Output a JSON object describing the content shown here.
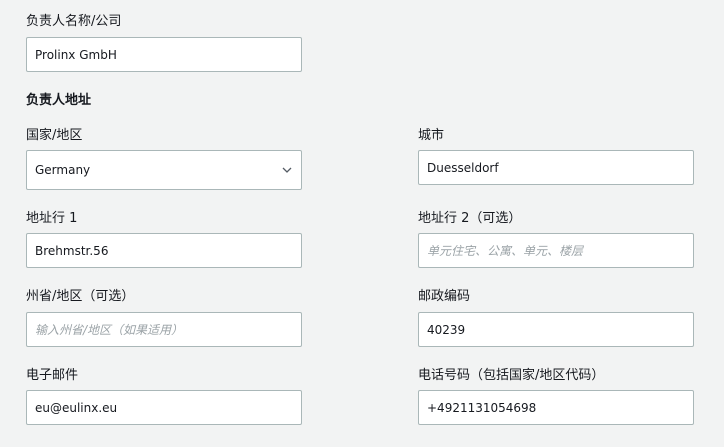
{
  "owner": {
    "name_label": "负责人名称/公司",
    "name_value": "Prolinx GmbH",
    "address_section_title": "负责人地址"
  },
  "country": {
    "label": "国家/地区",
    "value": "Germany"
  },
  "city": {
    "label": "城市",
    "value": "Duesseldorf"
  },
  "address_line1": {
    "label": "地址行 1",
    "value": "Brehmstr.56"
  },
  "address_line2": {
    "label": "地址行 2（可选）",
    "value": "",
    "placeholder": "单元住宅、公寓、单元、楼层"
  },
  "state": {
    "label": "州省/地区（可选）",
    "value": "",
    "placeholder": "输入州省/地区（如果适用）"
  },
  "postal_code": {
    "label": "邮政编码",
    "value": "40239"
  },
  "email": {
    "label": "电子邮件",
    "value": "eu@eulinx.eu"
  },
  "phone": {
    "label": "电话号码（包括国家/地区代码）",
    "value": "+4921131054698"
  },
  "icons": {
    "country_dropdown": "chevron-down-icon"
  }
}
